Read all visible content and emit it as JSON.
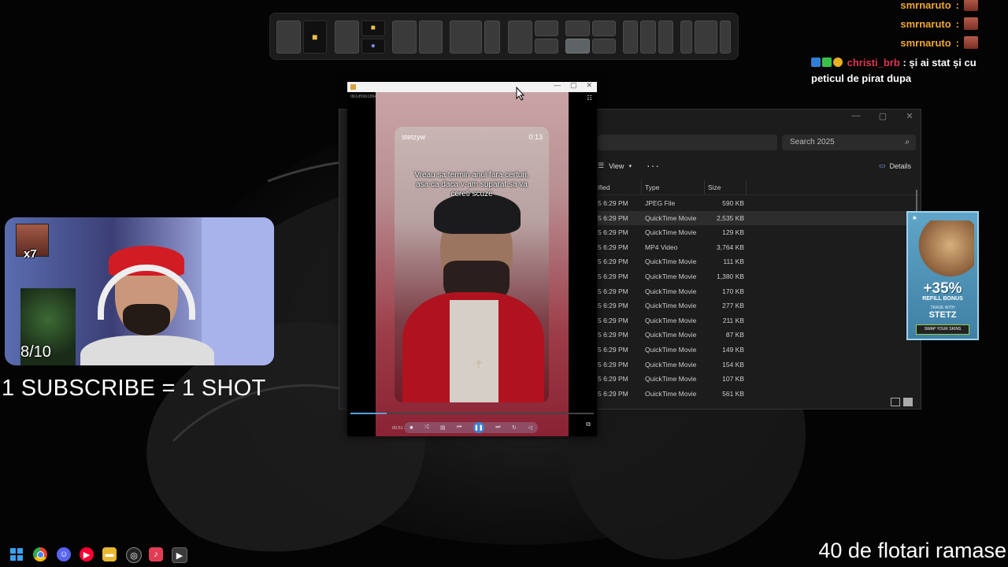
{
  "chat": {
    "lines": [
      {
        "user": "smrnaruto",
        "sep": ":"
      },
      {
        "user": "smrnaruto",
        "sep": ":"
      },
      {
        "user": "smrnaruto",
        "sep": ":"
      }
    ],
    "message_user": "christi_brb",
    "message_text": ": și ai stat și cu peticul de pirat dupa"
  },
  "explorer": {
    "search_placeholder": "Search 2025",
    "toolbar": {
      "view_label": "View",
      "more_label": "···",
      "details_label": "Details"
    },
    "columns": {
      "modified": "ified",
      "type": "Type",
      "size": "Size"
    },
    "rows": [
      {
        "date": "5 6:29 PM",
        "type": "JPEG File",
        "size": "590 KB",
        "selected": false
      },
      {
        "date": "5 6:29 PM",
        "type": "QuickTime Movie",
        "size": "2,535 KB",
        "selected": true
      },
      {
        "date": "5 6:29 PM",
        "type": "QuickTime Movie",
        "size": "129 KB",
        "selected": false
      },
      {
        "date": "5 6:29 PM",
        "type": "MP4 Video",
        "size": "3,764 KB",
        "selected": false
      },
      {
        "date": "5 6:29 PM",
        "type": "QuickTime Movie",
        "size": "111 KB",
        "selected": false
      },
      {
        "date": "5 6:29 PM",
        "type": "QuickTime Movie",
        "size": "1,380 KB",
        "selected": false
      },
      {
        "date": "5 6:29 PM",
        "type": "QuickTime Movie",
        "size": "170 KB",
        "selected": false
      },
      {
        "date": "5 6:29 PM",
        "type": "QuickTime Movie",
        "size": "277 KB",
        "selected": false
      },
      {
        "date": "5 6:29 PM",
        "type": "QuickTime Movie",
        "size": "211 KB",
        "selected": false
      },
      {
        "date": "5 6:29 PM",
        "type": "QuickTime Movie",
        "size": "87 KB",
        "selected": false
      },
      {
        "date": "5 6:29 PM",
        "type": "QuickTime Movie",
        "size": "149 KB",
        "selected": false
      },
      {
        "date": "5 6:29 PM",
        "type": "QuickTime Movie",
        "size": "154 KB",
        "selected": false
      },
      {
        "date": "5 6:29 PM",
        "type": "QuickTime Movie",
        "size": "107 KB",
        "selected": false
      },
      {
        "date": "5 6:29 PM",
        "type": "QuickTime Movie",
        "size": "561 KB",
        "selected": false
      }
    ]
  },
  "player": {
    "file_hash": "0b1d59b1894f760a6f8a9fa43a5e4e8",
    "tiktok_user": "stetzyw",
    "tiktok_time": "0:13",
    "caption": "Vreau sa termin anul fara certuri, asa ca daca v-am suparat sa va cereti scuze",
    "current_time": "00:51",
    "progress": 0.15
  },
  "webcam": {
    "counter": "8/10",
    "multiplier": "x7"
  },
  "overlay": {
    "subscribe_text": "1 SUBSCRIBE = 1 SHOT",
    "flotari_text": "40 de flotari ramase"
  },
  "ad": {
    "percent": "+35%",
    "subtitle": "REFILL BONUS",
    "trade": "TRADE WITH",
    "brand": "STETZ",
    "cta": "SWAP YOUR SKINS"
  },
  "colors": {
    "accent": "#3d7fd0",
    "chat_user": "#f0a830",
    "chat_user_alt": "#e0364f"
  },
  "taskbar": {
    "icons": [
      "windows-start-icon",
      "chrome-icon",
      "discord-icon",
      "youtube-icon",
      "file-explorer-icon",
      "github-icon",
      "tiktok-icon",
      "media-player-icon"
    ]
  }
}
